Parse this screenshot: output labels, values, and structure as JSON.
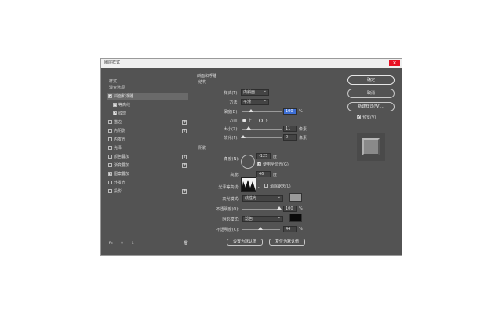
{
  "window": {
    "title": "图层样式",
    "close_glyph": "✕"
  },
  "left": {
    "title": "样式",
    "items": [
      {
        "label": "混合选项",
        "checkbox": false,
        "checked": false,
        "plus": false,
        "selected": false
      },
      {
        "label": "斜面和浮雕",
        "checkbox": true,
        "checked": true,
        "plus": false,
        "selected": true
      },
      {
        "label": "等高线",
        "checkbox": true,
        "checked": true,
        "plus": false,
        "selected": false,
        "indent": true
      },
      {
        "label": "纹理",
        "checkbox": true,
        "checked": true,
        "plus": false,
        "selected": false,
        "indent": true
      },
      {
        "label": "描边",
        "checkbox": true,
        "checked": false,
        "plus": true,
        "selected": false
      },
      {
        "label": "内阴影",
        "checkbox": true,
        "checked": false,
        "plus": true,
        "selected": false
      },
      {
        "label": "内发光",
        "checkbox": true,
        "checked": false,
        "plus": false,
        "selected": false
      },
      {
        "label": "光泽",
        "checkbox": true,
        "checked": false,
        "plus": false,
        "selected": false
      },
      {
        "label": "颜色叠加",
        "checkbox": true,
        "checked": false,
        "plus": true,
        "selected": false
      },
      {
        "label": "渐变叠加",
        "checkbox": true,
        "checked": false,
        "plus": true,
        "selected": false
      },
      {
        "label": "图案叠加",
        "checkbox": true,
        "checked": true,
        "plus": false,
        "selected": false
      },
      {
        "label": "外发光",
        "checkbox": true,
        "checked": false,
        "plus": false,
        "selected": false
      },
      {
        "label": "投影",
        "checkbox": true,
        "checked": false,
        "plus": true,
        "selected": false
      }
    ],
    "bottom": {
      "fx": "fx",
      "up": "⇧",
      "down": "⇩",
      "trash": "🗑"
    }
  },
  "main": {
    "section_title": "斜面和浮雕",
    "structure_label": "结构",
    "style_label": "样式(T):",
    "style_value": "内斜面",
    "method_label": "方法:",
    "method_value": "平滑",
    "depth_label": "深度(D):",
    "depth_value": "100",
    "depth_unit": "%",
    "direction_label": "方向:",
    "dir_up": "上",
    "dir_down": "下",
    "size_label": "大小(Z):",
    "size_value": "11",
    "size_unit": "像素",
    "soften_label": "软化(F):",
    "soften_value": "0",
    "soften_unit": "像素",
    "shading_label": "阴影",
    "angle_label": "角度(N):",
    "angle_value": "-125",
    "angle_unit": "度",
    "global_light_label": "使用全局光(G)",
    "altitude_label": "高度:",
    "altitude_value": "46",
    "altitude_unit": "度",
    "gloss_label": "光泽等高线:",
    "antialias_label": "消除锯齿(L)",
    "highlight_mode_label": "高光模式:",
    "highlight_mode_value": "线性光",
    "highlight_opacity_label": "不透明度(O):",
    "highlight_opacity_value": "100",
    "highlight_opacity_unit": "%",
    "shadow_mode_label": "阴影模式:",
    "shadow_mode_value": "滤色",
    "shadow_opacity_label": "不透明度(C):",
    "shadow_opacity_value": "44",
    "shadow_opacity_unit": "%",
    "set_default": "设置为默认值",
    "reset_default": "复位为默认值"
  },
  "right": {
    "ok": "确定",
    "cancel": "取消",
    "new_style": "新建样式(W)...",
    "preview_label": "预览(V)"
  },
  "colors": {
    "panel": "#535353",
    "highlight_swatch": "#9a9a9a",
    "shadow_swatch": "#0a0a0a"
  }
}
